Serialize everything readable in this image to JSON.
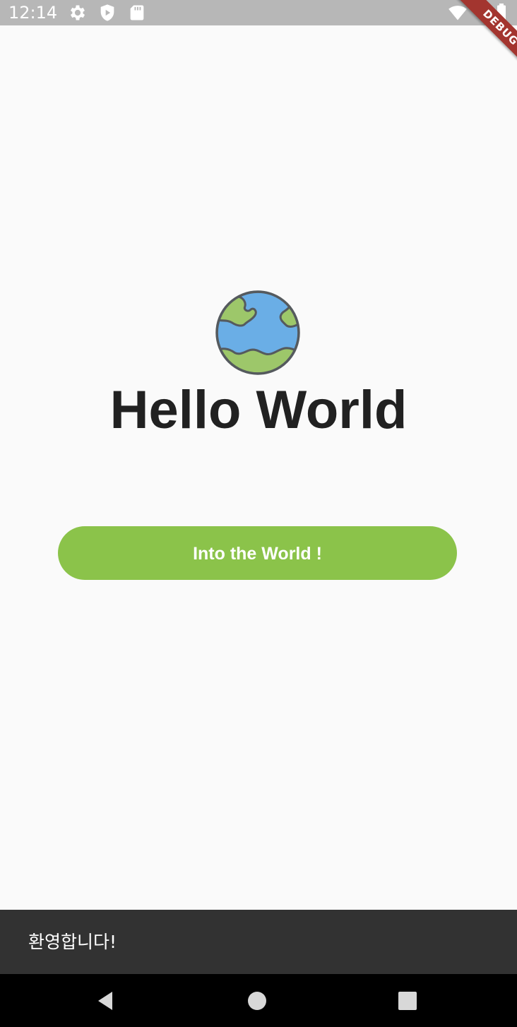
{
  "status_bar": {
    "time": "12:14",
    "icons": [
      "gear-icon",
      "shield-play-icon",
      "sd-card-icon",
      "wifi-icon",
      "battery-icon"
    ]
  },
  "debug_banner": {
    "label": "DEBUG",
    "color": "#a3352f"
  },
  "main": {
    "icon": "globe-icon",
    "title": "Hello World",
    "button_label": "Into the World !",
    "button_color": "#8bc34a"
  },
  "snackbar": {
    "message": "환영합니다!"
  },
  "nav_bar": {
    "buttons": [
      "back-icon",
      "home-icon",
      "recents-icon"
    ]
  }
}
